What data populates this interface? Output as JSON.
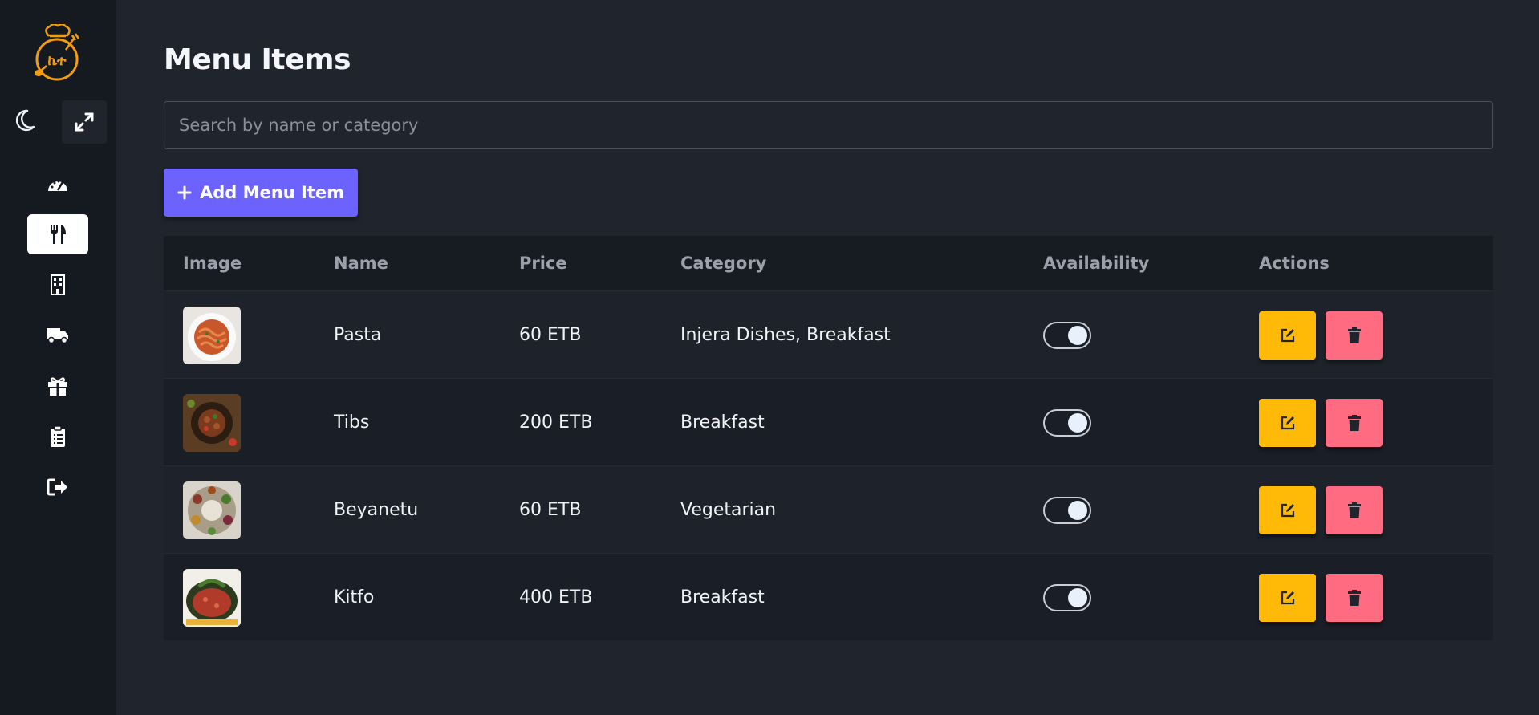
{
  "sidebar": {
    "logo": {
      "text": "ኬተ",
      "icon": "chef-hat-spoon-fork-logo",
      "color": "#f59e0b"
    },
    "theme_toggle_icon": "moon-icon",
    "fullscreen_icon": "expand-arrows-icon",
    "nav": [
      {
        "icon": "dashboard-gauge-icon",
        "active": false
      },
      {
        "icon": "utensils-icon",
        "active": true
      },
      {
        "icon": "building-icon",
        "active": false
      },
      {
        "icon": "delivery-truck-icon",
        "active": false
      },
      {
        "icon": "gift-icon",
        "active": false
      },
      {
        "icon": "clipboard-list-icon",
        "active": false
      },
      {
        "icon": "sign-out-icon",
        "active": false
      }
    ]
  },
  "page": {
    "title": "Menu Items",
    "search_placeholder": "Search by name or category",
    "add_button_label": "Add Menu Item"
  },
  "table": {
    "headers": {
      "image": "Image",
      "name": "Name",
      "price": "Price",
      "category": "Category",
      "availability": "Availability",
      "actions": "Actions"
    },
    "rows": [
      {
        "name": "Pasta",
        "price": "60 ETB",
        "category": "Injera Dishes, Breakfast",
        "available": true
      },
      {
        "name": "Tibs",
        "price": "200 ETB",
        "category": "Breakfast",
        "available": true
      },
      {
        "name": "Beyanetu",
        "price": "60 ETB",
        "category": "Vegetarian",
        "available": true
      },
      {
        "name": "Kitfo",
        "price": "400 ETB",
        "category": "Breakfast",
        "available": true
      }
    ]
  },
  "colors": {
    "sidebar_bg": "#151a21",
    "main_bg": "#1f242d",
    "accent": "#6c63ff",
    "edit": "#ffba08",
    "delete": "#ff6b81"
  }
}
